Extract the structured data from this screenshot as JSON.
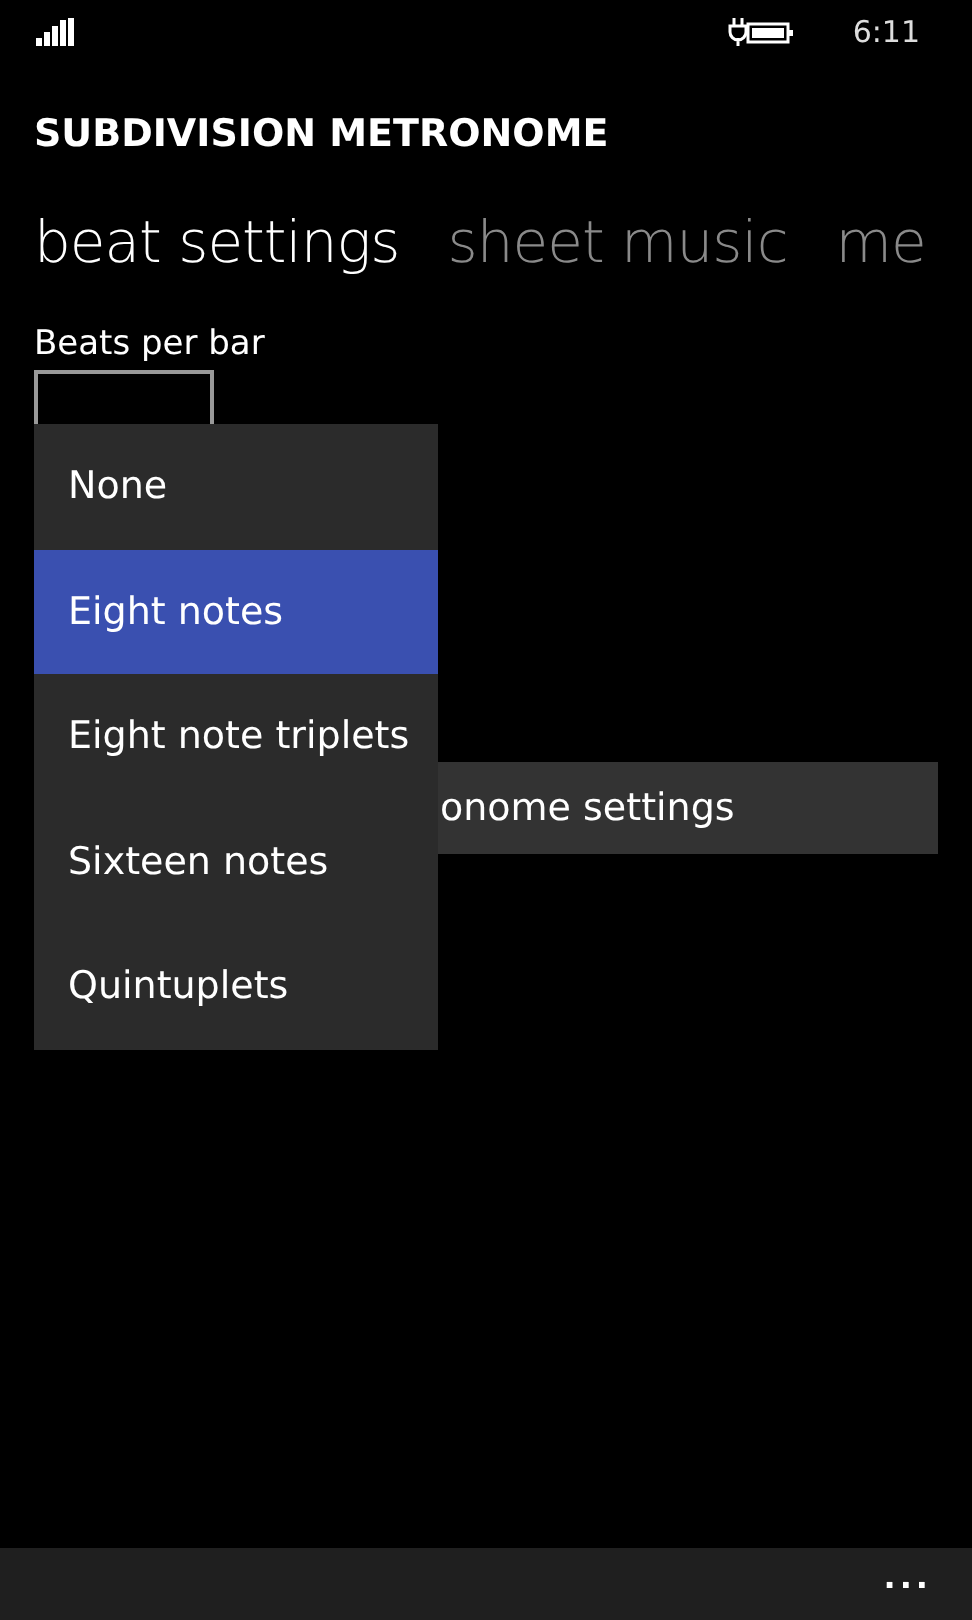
{
  "status_bar": {
    "time": "6:11"
  },
  "app": {
    "title": "SUBDIVISION METRONOME"
  },
  "pivot": [
    {
      "label": "beat settings",
      "selected": true
    },
    {
      "label": "sheet music",
      "selected": false
    },
    {
      "label": "me",
      "selected": false
    }
  ],
  "beats_per_bar": {
    "label": "Beats per bar"
  },
  "dropdown": {
    "items": [
      {
        "label": "None",
        "selected": false
      },
      {
        "label": "Eight notes",
        "selected": true
      },
      {
        "label": "Eight note triplets",
        "selected": false
      },
      {
        "label": "Sixteen notes",
        "selected": false
      },
      {
        "label": "Quintuplets",
        "selected": false
      }
    ]
  },
  "settings_button": {
    "label": "onome settings"
  },
  "app_bar": {
    "more": "..."
  }
}
